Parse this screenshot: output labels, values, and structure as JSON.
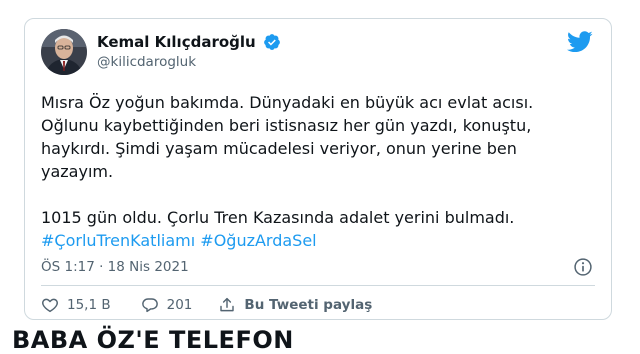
{
  "tweet": {
    "author": {
      "name": "Kemal Kılıçdaroğlu",
      "handle": "@kilicdarogluk",
      "verified": true,
      "avatar_icon": "profile-photo"
    },
    "brand_icon": "twitter-bird-icon",
    "brand_color": "#1d9bf0",
    "body": {
      "line1": "Mısra Öz yoğun bakımda. Dünyadaki en büyük acı evlat acısı.",
      "line2": "Oğlunu kaybettiğinden beri istisnasız her gün yazdı, konuştu,",
      "line3": "haykırdı. Şimdi yaşam mücadelesi veriyor, onun yerine ben",
      "line4": "yazayım.",
      "line5": "1015 gün oldu. Çorlu Tren Kazasında adalet yerini bulmadı.",
      "hashtags": [
        "#ÇorluTrenKatliamı",
        "#OğuzArdaSel"
      ]
    },
    "timestamp": "ÖS 1:17 · 18 Nis 2021",
    "actions": {
      "likes": "15,1 B",
      "replies": "201",
      "share_label": "Bu Tweeti paylaş"
    }
  },
  "below_headline": "BABA ÖZ'E TELEFON"
}
